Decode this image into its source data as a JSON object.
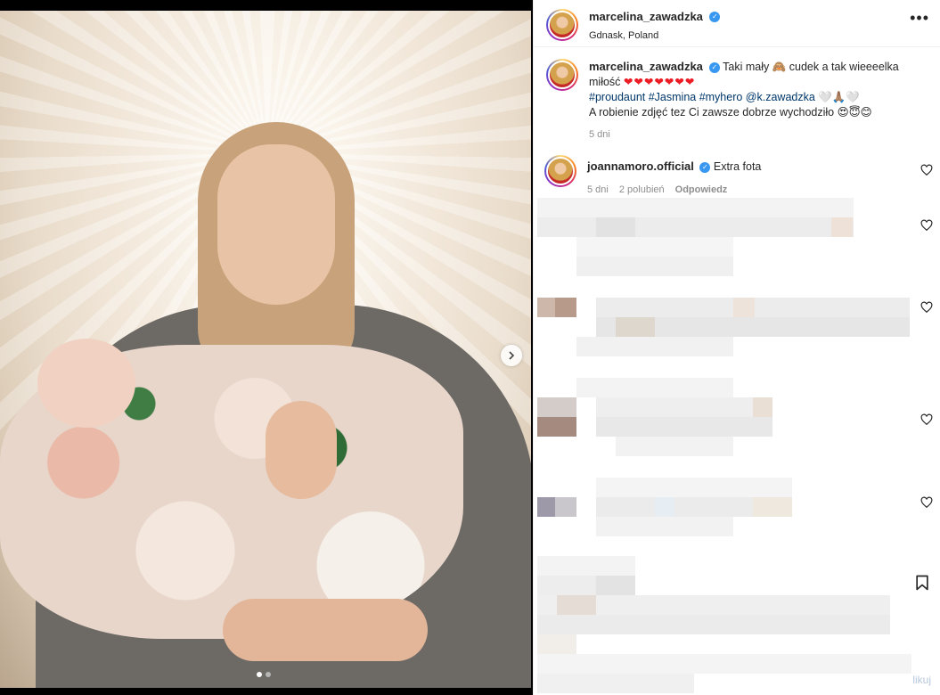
{
  "post": {
    "username": "marcelina_zawadzka",
    "location": "Gdnask, Poland",
    "more_label": "•••",
    "caption_text": "Taki mały 🙈 cudek a tak wieeeelka miłość",
    "caption_hearts": "❤❤❤❤❤❤❤",
    "caption_tags": "#proudaunt #Jasmina #myhero @k.zawadzka",
    "caption_tags_tail": "🤍🙏🏽🤍",
    "caption_line3": "A robienie zdjęć tez Ci zawsze dobrze wychodziło 😍😇😊",
    "caption_time": "5 dni",
    "media_next_label": "›",
    "carousel": {
      "count": 2,
      "active": 1
    }
  },
  "comment": {
    "username": "joannamoro.official",
    "text": "Extra fota",
    "time": "5 dni",
    "likes": "2 polubień",
    "reply": "Odpowiedz"
  },
  "footer": {
    "like_text": "likuj"
  },
  "icons": {
    "verified": "verified-badge-icon",
    "like": "heart-outline-icon",
    "save": "bookmark-icon",
    "more": "more-options-icon",
    "next": "chevron-right-icon"
  },
  "colors": {
    "verified": "#3897f0",
    "hashtag": "#00376b",
    "meta": "#8e8e8e",
    "heart": "#ed1c24"
  }
}
